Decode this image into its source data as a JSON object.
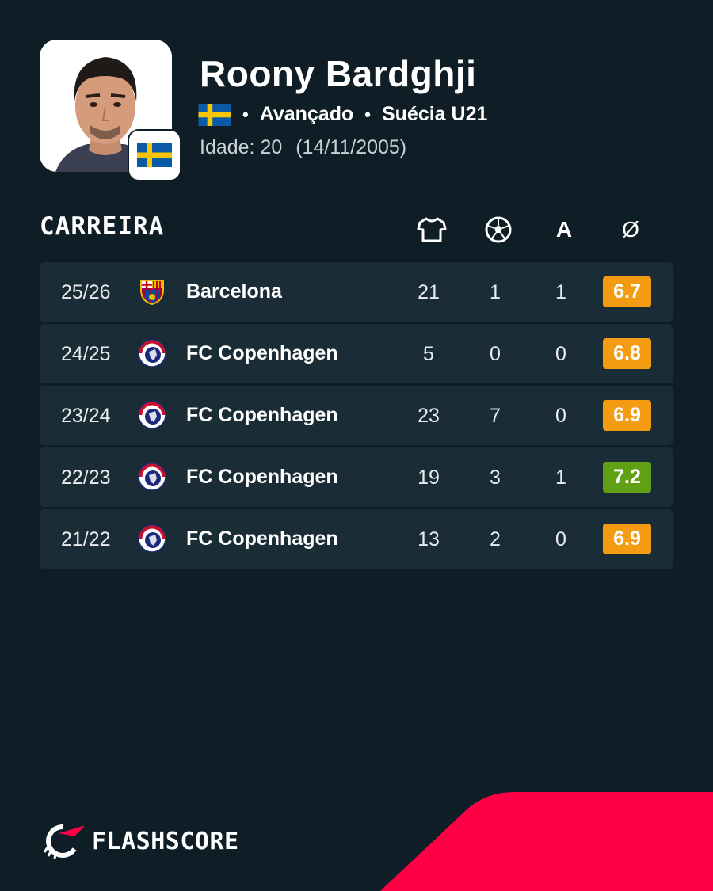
{
  "player": {
    "name": "Roony Bardghji",
    "position": "Avançado",
    "team": "Suécia U21",
    "age_label": "Idade: 20",
    "birth_date": "(14/11/2005)",
    "flag_icon": "sweden-flag-icon"
  },
  "career": {
    "title": "CARREIRA",
    "columns": [
      {
        "icon": "shirt-icon"
      },
      {
        "icon": "football-icon"
      },
      {
        "label": "A"
      },
      {
        "label": "Ø"
      }
    ],
    "rows": [
      {
        "season": "25/26",
        "club": "Barcelona",
        "crest": "barcelona-crest-icon",
        "apps": "21",
        "goals": "1",
        "assists": "1",
        "rating": "6.7",
        "rating_color": "#f39c12"
      },
      {
        "season": "24/25",
        "club": "FC Copenhagen",
        "crest": "copenhagen-crest-icon",
        "apps": "5",
        "goals": "0",
        "assists": "0",
        "rating": "6.8",
        "rating_color": "#f39c12"
      },
      {
        "season": "23/24",
        "club": "FC Copenhagen",
        "crest": "copenhagen-crest-icon",
        "apps": "23",
        "goals": "7",
        "assists": "0",
        "rating": "6.9",
        "rating_color": "#f39c12"
      },
      {
        "season": "22/23",
        "club": "FC Copenhagen",
        "crest": "copenhagen-crest-icon",
        "apps": "19",
        "goals": "3",
        "assists": "1",
        "rating": "7.2",
        "rating_color": "#5fa014"
      },
      {
        "season": "21/22",
        "club": "FC Copenhagen",
        "crest": "copenhagen-crest-icon",
        "apps": "13",
        "goals": "2",
        "assists": "0",
        "rating": "6.9",
        "rating_color": "#f39c12"
      }
    ]
  },
  "brand": {
    "name": "FLASHSCORE",
    "accent_color": "#ff0046",
    "background_color": "#0f1e26"
  }
}
